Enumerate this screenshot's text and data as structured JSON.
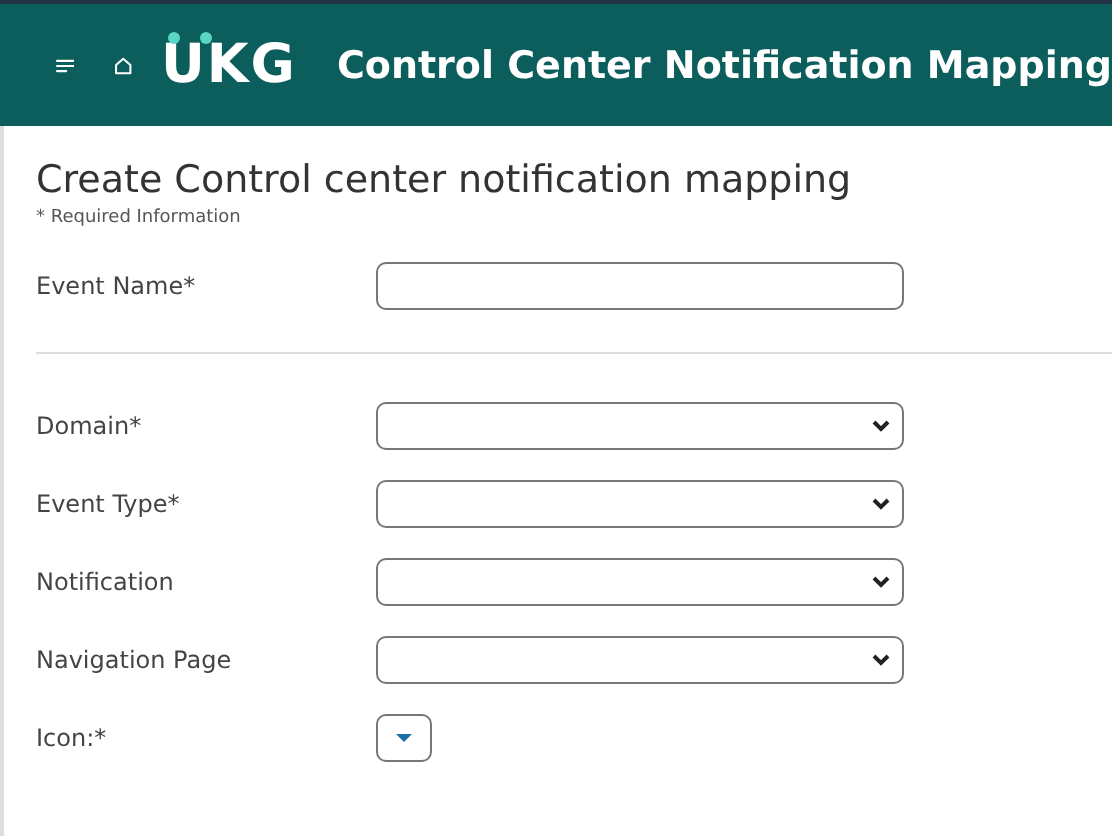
{
  "header": {
    "logo": "UKG",
    "title": "Control Center Notification Mapping"
  },
  "page": {
    "title": "Create Control center notification mapping",
    "note": "* Required Information"
  },
  "sections": [
    {
      "fields": [
        {
          "label": "Event Name*",
          "kind": "text"
        }
      ]
    },
    {
      "fields": [
        {
          "label": "Domain*",
          "kind": "select"
        },
        {
          "label": "Event Type*",
          "kind": "select"
        },
        {
          "label": "Notification",
          "kind": "select"
        },
        {
          "label": "Navigation Page",
          "kind": "select"
        },
        {
          "label": "Icon:*",
          "kind": "icon-picker"
        }
      ]
    }
  ]
}
